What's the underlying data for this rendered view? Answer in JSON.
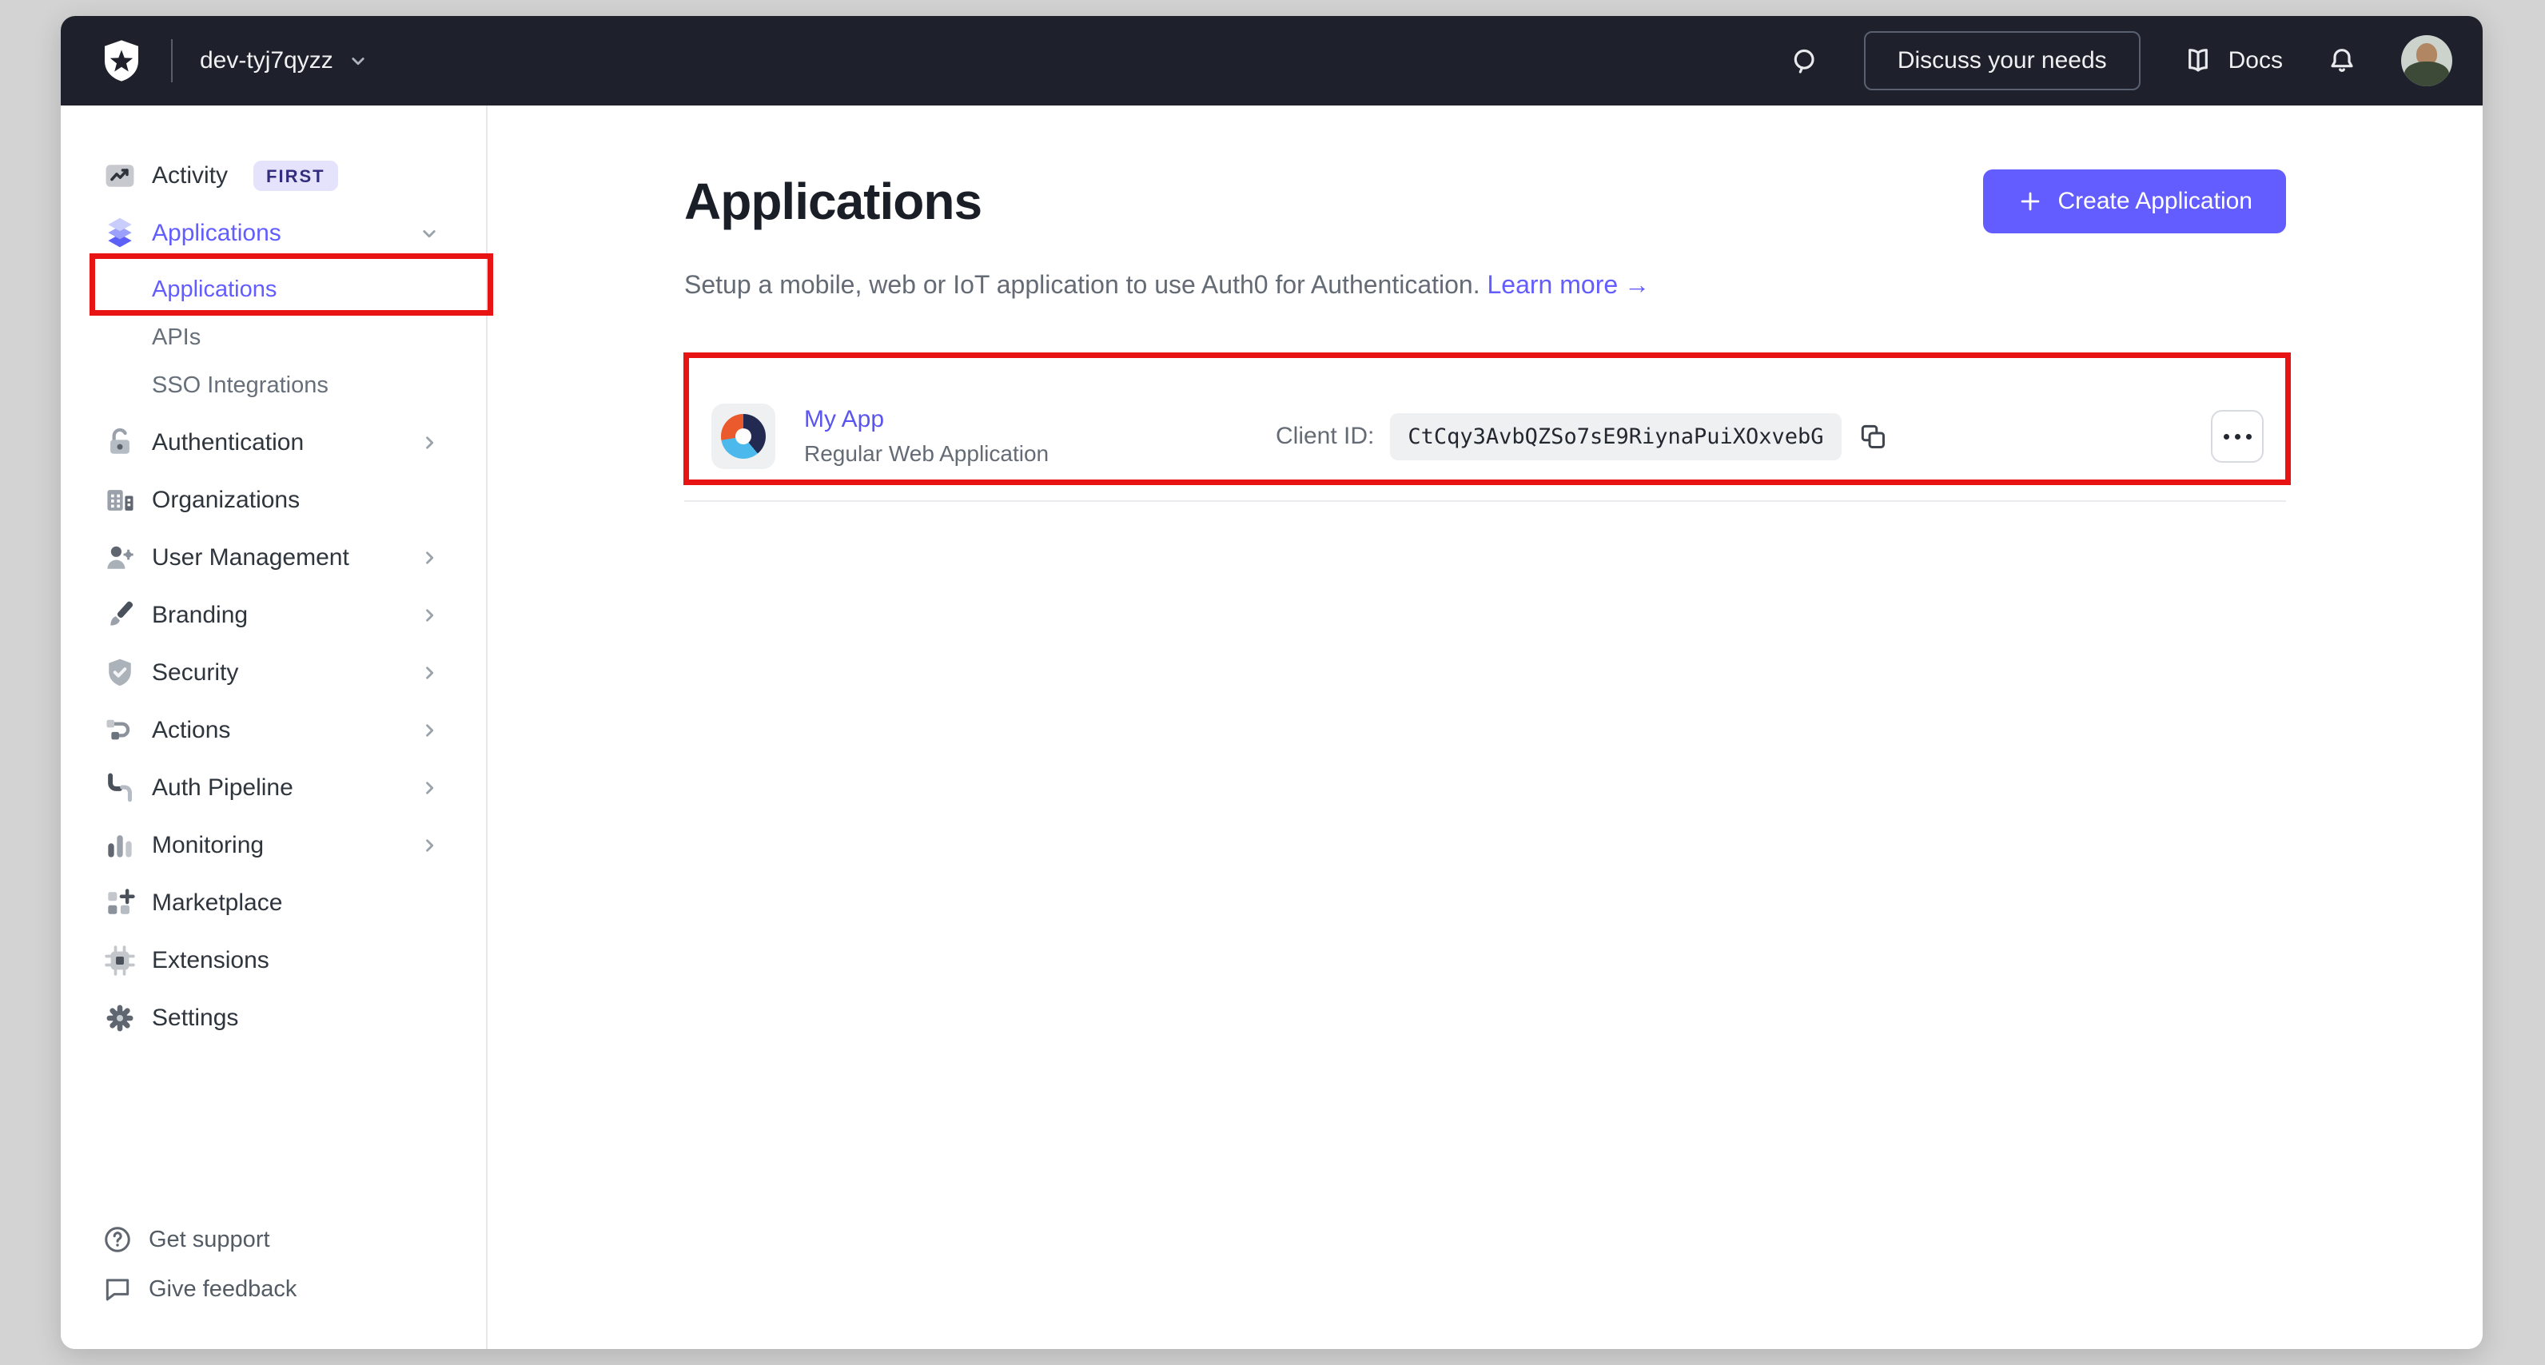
{
  "topbar": {
    "tenant": "dev-tyj7qyzz",
    "discuss_label": "Discuss your needs",
    "docs_label": "Docs"
  },
  "sidebar": {
    "items": [
      {
        "label": "Activity",
        "icon": "activity-chart-icon",
        "badge": "FIRST"
      },
      {
        "label": "Applications",
        "icon": "layers-icon",
        "state": "expanded",
        "active": true
      },
      {
        "label": "Applications",
        "level": "child",
        "active": true
      },
      {
        "label": "APIs",
        "level": "child"
      },
      {
        "label": "SSO Integrations",
        "level": "child"
      },
      {
        "label": "Authentication",
        "icon": "lock-icon",
        "expandable": true
      },
      {
        "label": "Organizations",
        "icon": "building-icon"
      },
      {
        "label": "User Management",
        "icon": "user-gear-icon",
        "expandable": true
      },
      {
        "label": "Branding",
        "icon": "paintbrush-icon",
        "expandable": true
      },
      {
        "label": "Security",
        "icon": "shield-check-icon",
        "expandable": true
      },
      {
        "label": "Actions",
        "icon": "flow-icon",
        "expandable": true
      },
      {
        "label": "Auth Pipeline",
        "icon": "pipeline-icon",
        "expandable": true
      },
      {
        "label": "Monitoring",
        "icon": "bar-chart-icon",
        "expandable": true
      },
      {
        "label": "Marketplace",
        "icon": "grid-plus-icon"
      },
      {
        "label": "Extensions",
        "icon": "chip-icon"
      },
      {
        "label": "Settings",
        "icon": "gear-icon"
      }
    ],
    "footer": [
      {
        "label": "Get support",
        "icon": "help-circle-icon"
      },
      {
        "label": "Give feedback",
        "icon": "speech-bubble-icon"
      }
    ]
  },
  "main": {
    "heading": "Applications",
    "description": "Setup a mobile, web or IoT application to use Auth0 for Authentication.",
    "learn_more_label": "Learn more",
    "learn_more_arrow": "→",
    "create_button_label": "Create Application",
    "application_row": {
      "name": "My App",
      "type": "Regular Web Application",
      "client_id_label": "Client ID:",
      "client_id": "CtCqy3AvbQZSo7sE9RiynaPuiXOxvebG"
    }
  },
  "colors": {
    "accent": "#635dff",
    "topbar_bg": "#1e212b",
    "annotation_red": "#e81313",
    "badge_bg": "#e5e2fc",
    "badge_text": "#332d7d",
    "code_bg": "#eef0f2",
    "page_bg": "#d3d3d3"
  }
}
